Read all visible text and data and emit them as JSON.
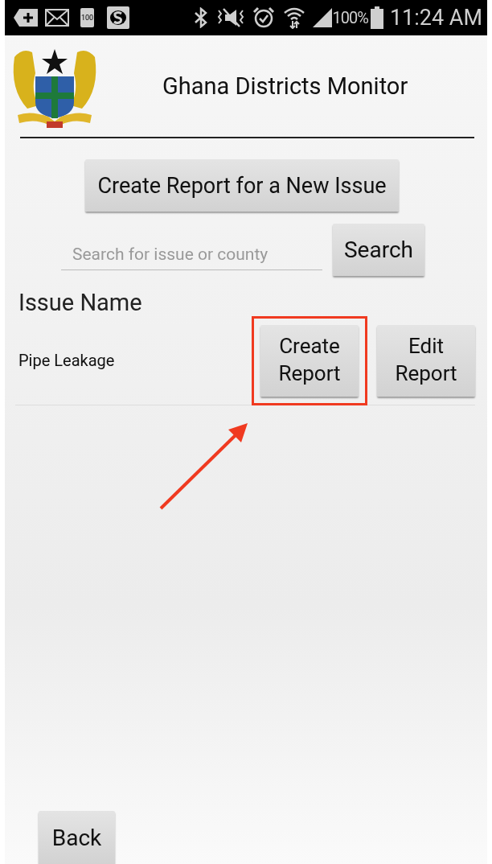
{
  "status_bar": {
    "notification_badge": "100",
    "battery": "100%",
    "time": "11:24 AM"
  },
  "header": {
    "title": "Ghana Districts Monitor"
  },
  "new_issue_button": "Create Report for a New Issue",
  "search": {
    "placeholder": "Search for issue or county",
    "button": "Search"
  },
  "list_heading": "Issue Name",
  "issues": [
    {
      "name": "Pipe Leakage",
      "actions": [
        {
          "label": "Create Report",
          "highlighted": true
        },
        {
          "label": "Edit Report",
          "highlighted": false
        }
      ]
    }
  ],
  "back_button": "Back"
}
